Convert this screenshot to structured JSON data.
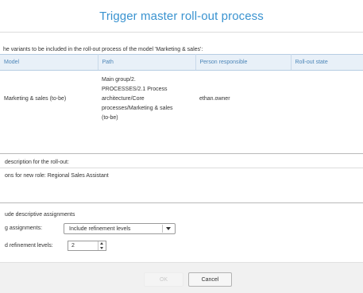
{
  "dialog": {
    "title": "Trigger master roll-out process",
    "intro_text": "he variants to be included in the roll-out process of the model 'Marketing & sales':"
  },
  "table": {
    "columns": [
      "Model",
      "Path",
      "Person responsible",
      "Roll-out state"
    ],
    "rows": [
      {
        "model": "Marketing & sales (to-be)",
        "path_lines": [
          "Main group/2.",
          "PROCESSES/2.1 Process",
          "architecture/Core",
          "processes/Marketing & sales",
          "(to-be)"
        ],
        "person": "ethan.owner",
        "state": ""
      }
    ]
  },
  "description": {
    "label": "description for the roll-out:",
    "text": "ons for new role: Regional Sales Assistant"
  },
  "assignments": {
    "section_title": "ude descriptive assignments",
    "assign_label": "g assignments:",
    "assign_value": "Include refinement levels",
    "levels_label": "d refinement levels:",
    "levels_value": "2"
  },
  "footer": {
    "ok_label": "OK",
    "cancel_label": "Cancel"
  },
  "colors": {
    "title": "#3a93d0",
    "header_bg": "#e8f0f8",
    "header_text": "#4d86b8"
  }
}
